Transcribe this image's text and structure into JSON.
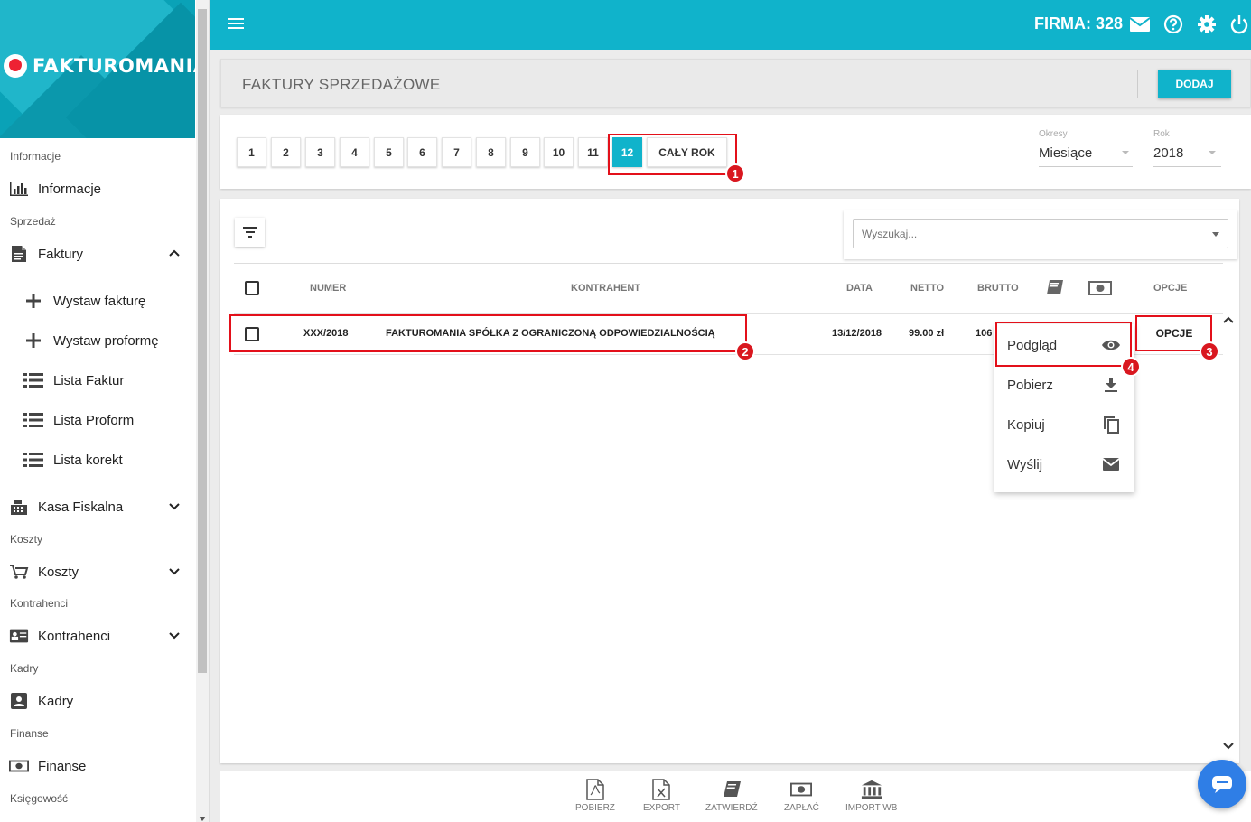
{
  "topbar": {
    "firma": "FIRMA: 328"
  },
  "brand": {
    "name": "FAKTUROMANIA"
  },
  "sidebar": {
    "sections": {
      "informacje": "Informacje",
      "sprzedaz": "Sprzedaż",
      "koszty": "Koszty",
      "kontrahenci": "Kontrahenci",
      "kadry": "Kadry",
      "finanse": "Finanse",
      "ksiegowosc": "Księgowość"
    },
    "items": {
      "informacje": "Informacje",
      "faktury": "Faktury",
      "wystaw_fakture": "Wystaw fakturę",
      "wystaw_proforme": "Wystaw proformę",
      "lista_faktur": "Lista Faktur",
      "lista_proform": "Lista Proform",
      "lista_korekt": "Lista korekt",
      "kasa_fiskalna": "Kasa Fiskalna",
      "koszty": "Koszty",
      "kontrahenci": "Kontrahenci",
      "kadry": "Kadry",
      "finanse": "Finanse"
    }
  },
  "header": {
    "title": "FAKTURY SPRZEDAŻOWE",
    "add_label": "DODAJ"
  },
  "months": {
    "buttons": [
      "1",
      "2",
      "3",
      "4",
      "5",
      "6",
      "7",
      "8",
      "9",
      "10",
      "11",
      "12"
    ],
    "active": "12",
    "full_year": "CAŁY ROK"
  },
  "filters": {
    "period_label": "Okresy",
    "period_value": "Miesiące",
    "year_label": "Rok",
    "year_value": "2018"
  },
  "search": {
    "placeholder": "Wyszukaj..."
  },
  "table": {
    "headers": {
      "numer": "NUMER",
      "kontrahent": "KONTRAHENT",
      "data": "DATA",
      "netto": "NETTO",
      "brutto": "BRUTTO",
      "opcje": "OPCJE"
    },
    "rows": [
      {
        "numer": "XXX/2018",
        "kontrahent": "FAKTUROMANIA SPÓŁKA Z OGRANICZONĄ ODPOWIEDZIALNOŚCIĄ",
        "data": "13/12/2018",
        "netto": "99.00 zł",
        "brutto": "106",
        "opcje": "OPCJE"
      }
    ]
  },
  "options_menu": {
    "items": [
      {
        "label": "Podgląd",
        "icon": "eye-icon"
      },
      {
        "label": "Pobierz",
        "icon": "download-icon"
      },
      {
        "label": "Kopiuj",
        "icon": "copy-icon"
      },
      {
        "label": "Wyślij",
        "icon": "mail-icon"
      }
    ]
  },
  "annotations": [
    "1",
    "2",
    "3",
    "4"
  ],
  "bottom_bar": {
    "pobierz": "POBIERZ",
    "export": "EXPORT",
    "zatwierdz": "ZATWIERDŹ",
    "zaplac": "ZAPŁAĆ",
    "import_wb": "IMPORT WB"
  },
  "colors": {
    "accent": "#10b3cb",
    "highlight": "#e3101a",
    "chat": "#2f7ee6"
  }
}
